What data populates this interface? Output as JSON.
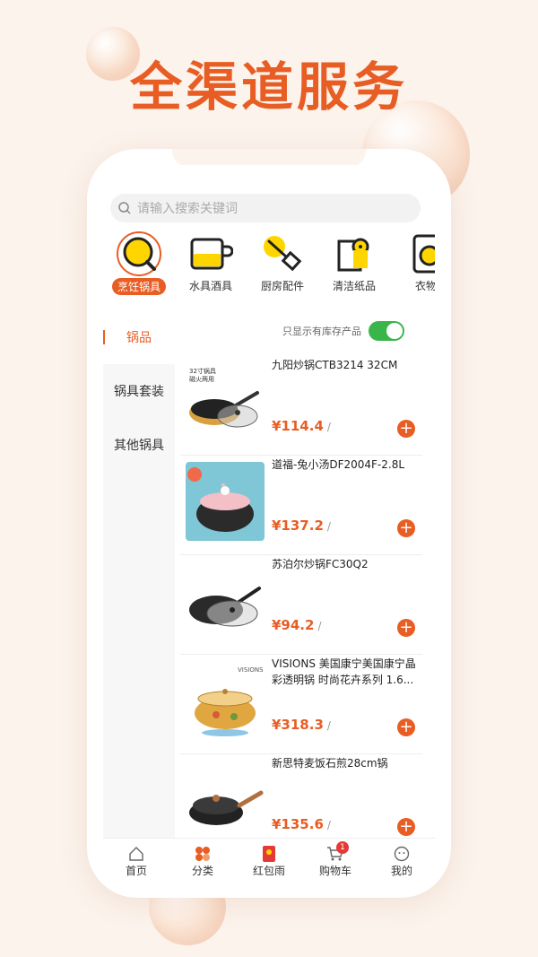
{
  "headline": "全渠道服务",
  "search": {
    "placeholder": "请输入搜索关键词"
  },
  "categories": [
    {
      "label": "烹饪锅具",
      "icon": "pan-icon",
      "active": true
    },
    {
      "label": "水具酒具",
      "icon": "cup-icon",
      "active": false
    },
    {
      "label": "厨房配件",
      "icon": "spatula-icon",
      "active": false
    },
    {
      "label": "清洁纸品",
      "icon": "tissue-roll-icon",
      "active": false
    },
    {
      "label": "衣物",
      "icon": "washer-icon",
      "active": false
    }
  ],
  "sidebar": {
    "items": [
      {
        "label": "锅品",
        "active": true
      },
      {
        "label": "锅具套装",
        "active": false
      },
      {
        "label": "其他锅具",
        "active": false
      }
    ]
  },
  "filter": {
    "label": "只显示有库存产品",
    "enabled": true
  },
  "products": [
    {
      "title": "九阳炒锅CTB3214 32CM",
      "price": "¥114.4",
      "unit": "/",
      "img_label": "32寸锅具 磁火两用"
    },
    {
      "title": "道福-兔小汤DF2004F-2.8L",
      "price": "¥137.2",
      "unit": "/"
    },
    {
      "title": "苏泊尔炒锅FC30Q2",
      "price": "¥94.2",
      "unit": "/"
    },
    {
      "title": "VISIONS 美国康宁美国康宁晶彩透明锅 时尚花卉系列 1.6...",
      "price": "¥318.3",
      "unit": "/",
      "img_label": "VISIONS"
    },
    {
      "title": "新思特麦饭石煎28cm锅",
      "price": "¥135.6",
      "unit": "/"
    }
  ],
  "tabs": [
    {
      "label": "首页",
      "icon": "home-icon"
    },
    {
      "label": "分类",
      "icon": "category-icon"
    },
    {
      "label": "红包雨",
      "icon": "red-envelope-icon"
    },
    {
      "label": "购物车",
      "icon": "cart-icon",
      "badge": "1"
    },
    {
      "label": "我的",
      "icon": "profile-icon"
    }
  ],
  "colors": {
    "accent": "#e85d23",
    "toggle": "#3ab54a",
    "icon_yellow": "#ffd500",
    "badge": "#e53935"
  }
}
